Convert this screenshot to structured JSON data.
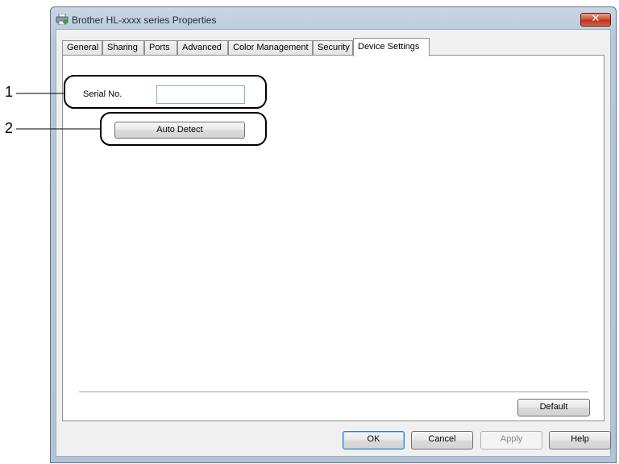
{
  "window": {
    "title": "Brother HL-xxxx series Properties",
    "close_label": "✕"
  },
  "tabs": [
    {
      "label": "General",
      "active": false
    },
    {
      "label": "Sharing",
      "active": false
    },
    {
      "label": "Ports",
      "active": false
    },
    {
      "label": "Advanced",
      "active": false
    },
    {
      "label": "Color Management",
      "active": false
    },
    {
      "label": "Security",
      "active": false
    },
    {
      "label": "Device Settings",
      "active": true
    }
  ],
  "device_settings": {
    "serial_label": "Serial No.",
    "serial_value": "",
    "auto_detect_label": "Auto Detect",
    "default_label": "Default"
  },
  "footer": {
    "ok_label": "OK",
    "cancel_label": "Cancel",
    "apply_label": "Apply",
    "help_label": "Help"
  },
  "callouts": {
    "first": "1",
    "second": "2"
  },
  "colors": {
    "accent": "#3c7fb1",
    "close": "#cf4a32"
  }
}
